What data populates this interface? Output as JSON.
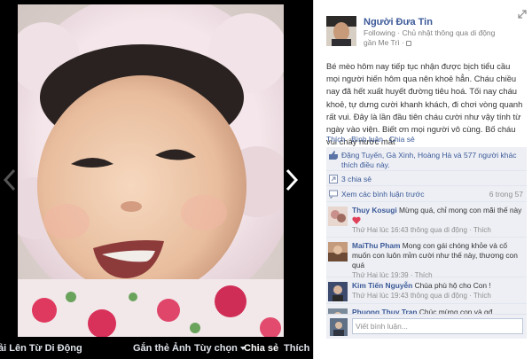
{
  "viewer": {
    "photo_alt": "",
    "actions": {
      "album": "ải Lên Từ Di Động",
      "tag": "Gắn thẻ Ảnh",
      "options": "Tùy chọn",
      "share": "Chia sẻ",
      "like": "Thích"
    }
  },
  "post": {
    "author": "Người Đưa Tin",
    "meta_line1": "Following · Chủ nhật thông qua di động",
    "meta_line2": "gần Me Trì ·",
    "text": "Bé mèo hôm nay tiếp tục nhận được bịch tiểu cầu mọi người hiến hôm qua nên khoẻ hẳn. Cháu chiều nay đã hết xuất huyết đường tiêu hoá. Tối nay cháu khoẻ, tự dưng cười khanh khách, đi chơi vòng quanh rất vui. Đây là lần đầu tiên cháu cười như vậy tính từ ngày vào viện. Biết ơn mọi người vô cùng. Bố cháu vui chảy nước mắt",
    "actions": {
      "like": "Thích",
      "comment": "Bình luận",
      "share": "Chia sẻ"
    },
    "likes_text": "Đặng Tuyến, Gà Xinh, Hoàng Hà và 577 người khác thích điều này.",
    "shares_text": "3 chia sẻ",
    "view_more": "Xem các bình luận trước",
    "view_count": "6 trong 57"
  },
  "comments": [
    {
      "name": "Thuy Kosugi",
      "text": "Mừng quá, chỉ mong con mãi thế này",
      "meta": "Thứ Hai lúc 16:43 thông qua di động · Thích"
    },
    {
      "name": "MaiThu Pham",
      "text": "Mong con gái chóng khỏe và cố muốn con luôn mỉm cười như thế này, thương con quá",
      "meta": "Thứ Hai lúc 19:39 · Thích"
    },
    {
      "name": "Kim Tiến Nguyễn",
      "text": "Chúa phù hộ cho Con !",
      "meta": "Thứ Hai lúc 19:43 thông qua di động · Thích"
    },
    {
      "name": "Phuong Thuy Tran",
      "text": "Chúc mừng con và gđ"
    }
  ],
  "write_comment_placeholder": "Viết bình luận...",
  "colors": {
    "link": "#3b5998",
    "panel_bg": "#ffffff",
    "feedback_bg": "#edeff4",
    "viewer_bg": "#000000"
  },
  "icons": [
    "prev-arrow-icon",
    "next-arrow-icon",
    "expand-icon",
    "like-thumb-icon",
    "share-icon",
    "comment-icon",
    "lock-icon",
    "heart-icon",
    "chevron-down-icon"
  ]
}
